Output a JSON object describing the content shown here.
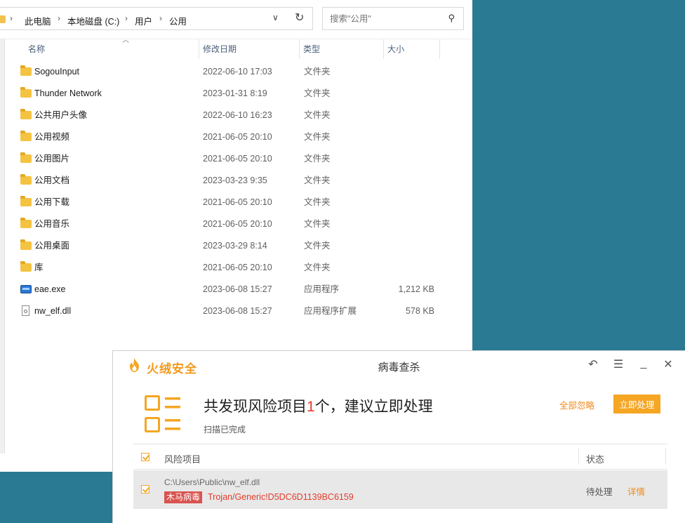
{
  "explorer": {
    "breadcrumb": [
      "此电脑",
      "本地磁盘 (C:)",
      "用户",
      "公用"
    ],
    "search_placeholder": "搜索\"公用\"",
    "columns": {
      "name": "名称",
      "date": "修改日期",
      "type": "类型",
      "size": "大小"
    },
    "files": [
      {
        "name": "SogouInput",
        "date": "2022-06-10 17:03",
        "type": "文件夹",
        "size": "",
        "icon": "folder-icon"
      },
      {
        "name": "Thunder Network",
        "date": "2023-01-31 8:19",
        "type": "文件夹",
        "size": "",
        "icon": "folder-icon"
      },
      {
        "name": "公共用户头像",
        "date": "2022-06-10 16:23",
        "type": "文件夹",
        "size": "",
        "icon": "folder-icon"
      },
      {
        "name": "公用视频",
        "date": "2021-06-05 20:10",
        "type": "文件夹",
        "size": "",
        "icon": "folder-icon"
      },
      {
        "name": "公用图片",
        "date": "2021-06-05 20:10",
        "type": "文件夹",
        "size": "",
        "icon": "folder-icon"
      },
      {
        "name": "公用文档",
        "date": "2023-03-23 9:35",
        "type": "文件夹",
        "size": "",
        "icon": "folder-icon"
      },
      {
        "name": "公用下载",
        "date": "2021-06-05 20:10",
        "type": "文件夹",
        "size": "",
        "icon": "folder-icon"
      },
      {
        "name": "公用音乐",
        "date": "2021-06-05 20:10",
        "type": "文件夹",
        "size": "",
        "icon": "folder-icon"
      },
      {
        "name": "公用桌面",
        "date": "2023-03-29 8:14",
        "type": "文件夹",
        "size": "",
        "icon": "folder-icon"
      },
      {
        "name": "库",
        "date": "2021-06-05 20:10",
        "type": "文件夹",
        "size": "",
        "icon": "folder-icon"
      },
      {
        "name": "eae.exe",
        "date": "2023-06-08 15:27",
        "type": "应用程序",
        "size": "1,212 KB",
        "icon": "exe-icon"
      },
      {
        "name": "nw_elf.dll",
        "date": "2023-06-08 15:27",
        "type": "应用程序扩展",
        "size": "578 KB",
        "icon": "dll-icon"
      }
    ]
  },
  "antivirus": {
    "brand": "火绒安全",
    "title": "病毒查杀",
    "headline_pre": "共发现风险项目",
    "headline_count": "1",
    "headline_post": "个，建议立即处理",
    "scan_status": "扫描已完成",
    "ignore_all_label": "全部忽略",
    "handle_now_label": "立即处理",
    "table_header": {
      "risk": "风险项目",
      "status": "状态"
    },
    "item": {
      "path": "C:\\Users\\Public\\nw_elf.dll",
      "badge": "木马病毒",
      "threat": "Trojan/Generic!D5DC6D1139BC6159",
      "status": "待处理",
      "detail_label": "详情"
    },
    "accent_color": "#f5a623",
    "danger_color": "#e53a2a"
  }
}
